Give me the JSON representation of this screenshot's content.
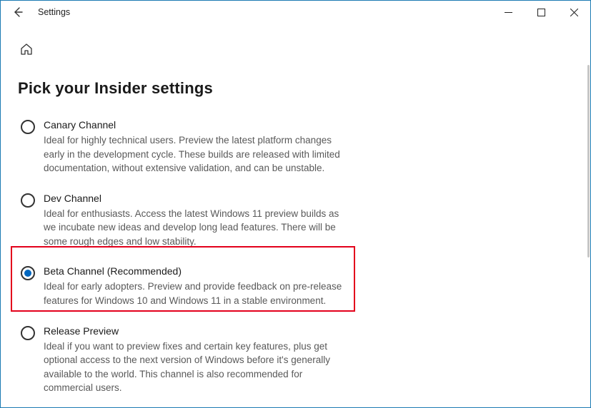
{
  "window": {
    "title": "Settings"
  },
  "page": {
    "heading": "Pick your Insider settings"
  },
  "options": [
    {
      "key": "canary",
      "label": "Canary Channel",
      "description": "Ideal for highly technical users. Preview the latest platform changes early in the development cycle. These builds are released with limited documentation, without extensive validation, and can be unstable.",
      "selected": false
    },
    {
      "key": "dev",
      "label": "Dev Channel",
      "description": "Ideal for enthusiasts. Access the latest Windows 11 preview builds as we incubate new ideas and develop long lead features. There will be some rough edges and low stability.",
      "selected": false
    },
    {
      "key": "beta",
      "label": "Beta Channel (Recommended)",
      "description": "Ideal for early adopters. Preview and provide feedback on pre-release features for Windows 10 and Windows 11 in a stable environment.",
      "selected": true
    },
    {
      "key": "release",
      "label": "Release Preview",
      "description": "Ideal if you want to preview fixes and certain key features, plus get optional access to the next version of Windows before it's generally available to the world. This channel is also recommended for commercial users.",
      "selected": false
    }
  ]
}
